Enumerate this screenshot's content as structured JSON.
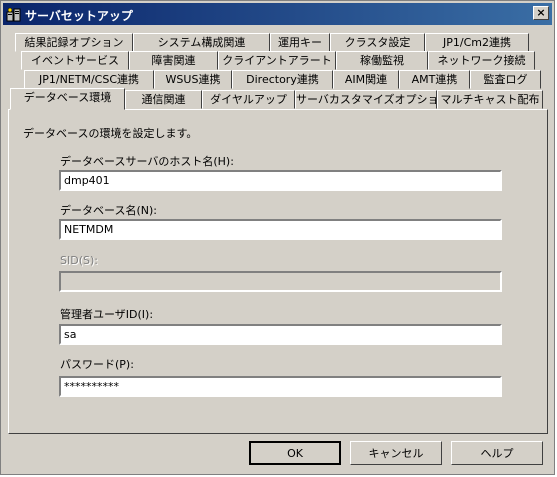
{
  "window": {
    "title": "サーバセットアップ",
    "close_glyph": "×"
  },
  "tabs": {
    "row1": [
      "結果記録オプション",
      "システム構成関連",
      "運用キー",
      "クラスタ設定",
      "JP1/Cm2連携"
    ],
    "row2": [
      "イベントサービス",
      "障害関連",
      "クライアントアラート",
      "稼働監視",
      "ネットワーク接続"
    ],
    "row3": [
      "JP1/NETM/CSC連携",
      "WSUS連携",
      "Directory連携",
      "AIM関連",
      "AMT連携",
      "監査ログ"
    ],
    "row4": [
      "データベース環境",
      "通信関連",
      "ダイヤルアップ",
      "サーバカスタマイズオプション",
      "マルチキャスト配布"
    ],
    "active": "データベース環境"
  },
  "form": {
    "description": "データベースの環境を設定します。",
    "host_label": "データベースサーバのホスト名(H):",
    "host_value": "dmp401",
    "dbname_label": "データベース名(N):",
    "dbname_value": "NETMDM",
    "sid_label": "SID(S):",
    "sid_value": "",
    "userid_label": "管理者ユーザID(I):",
    "userid_value": "sa",
    "password_label": "パスワード(P):",
    "password_value": "**********"
  },
  "buttons": {
    "ok": "OK",
    "cancel": "キャンセル",
    "help": "ヘルプ"
  }
}
